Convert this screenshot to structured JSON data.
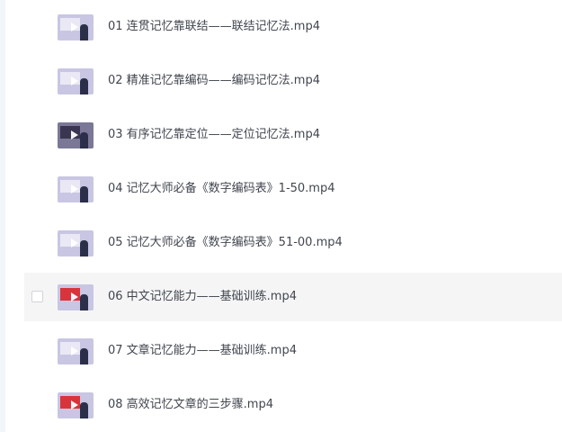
{
  "files": [
    {
      "name": "01 连贯记忆靠联结——联结记忆法.mp4",
      "thumb": "video-thumbnail"
    },
    {
      "name": "02 精准记忆靠编码——编码记忆法.mp4",
      "thumb": "video-thumbnail"
    },
    {
      "name": "03 有序记忆靠定位——定位记忆法.mp4",
      "thumb": "video-thumbnail"
    },
    {
      "name": "04 记忆大师必备《数字编码表》1-50.mp4",
      "thumb": "video-thumbnail"
    },
    {
      "name": "05 记忆大师必备《数字编码表》51-00.mp4",
      "thumb": "video-thumbnail"
    },
    {
      "name": "06 中文记忆能力——基础训练.mp4",
      "thumb": "video-thumbnail"
    },
    {
      "name": "07 文章记忆能力——基础训练.mp4",
      "thumb": "video-thumbnail"
    },
    {
      "name": "08 高效记忆文章的三步骤.mp4",
      "thumb": "video-thumbnail"
    }
  ],
  "colors": {
    "text": "#41464f",
    "row_hover": "#f5f5f6",
    "thumb_bg": "#c8c6e2"
  }
}
